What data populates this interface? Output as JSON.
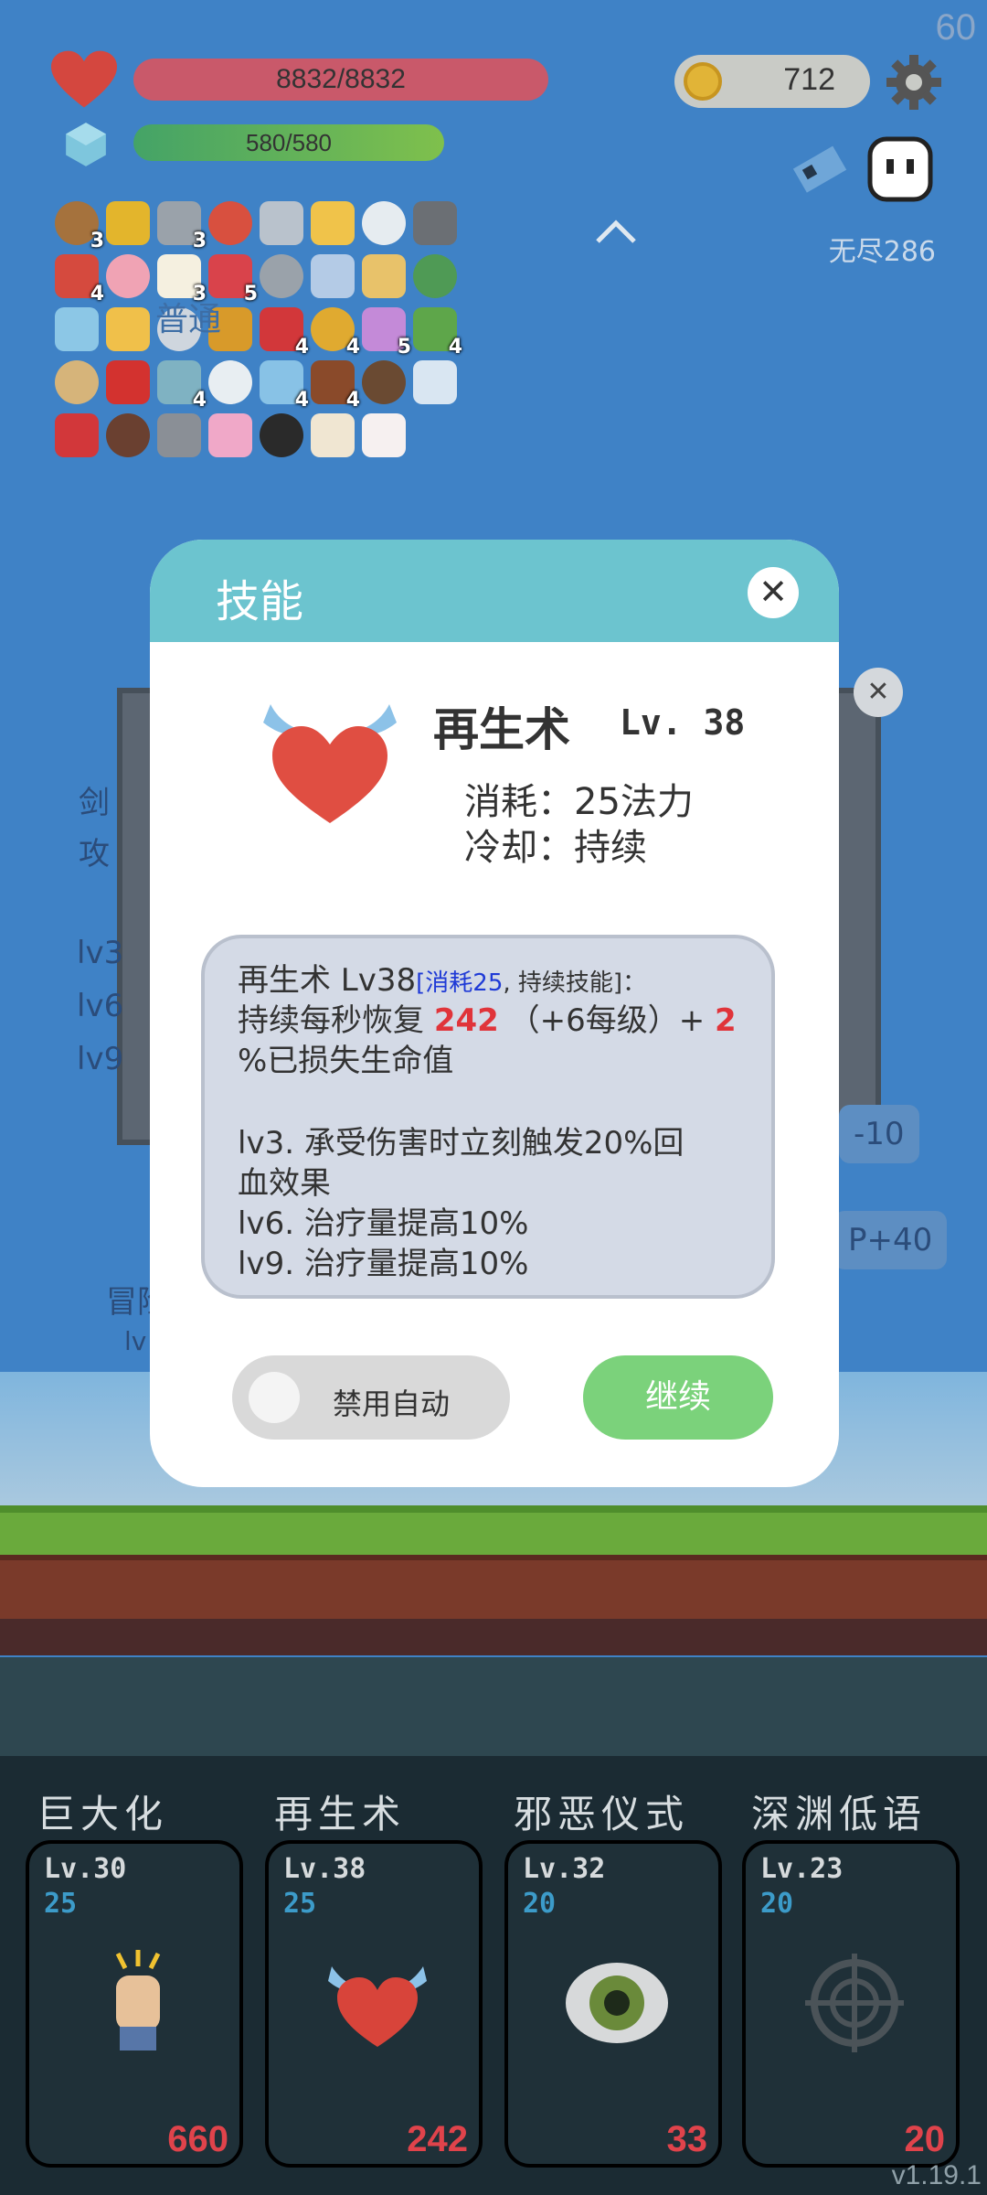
{
  "hud": {
    "fps": "60",
    "hp_text": "8832/8832",
    "mp_text": "580/580",
    "coins": "712",
    "endless_label": "无尽286"
  },
  "items": [
    {
      "icon": "shield-round-icon",
      "count": "3"
    },
    {
      "icon": "sunflower-icon",
      "count": ""
    },
    {
      "icon": "meteor-icon",
      "count": "3"
    },
    {
      "icon": "red-shield-icon",
      "count": ""
    },
    {
      "icon": "sword-icon",
      "count": ""
    },
    {
      "icon": "sun-icon",
      "count": ""
    },
    {
      "icon": "briefcase-icon",
      "count": ""
    },
    {
      "icon": "helmet-icon",
      "count": ""
    },
    {
      "icon": "sock-icon",
      "count": "4"
    },
    {
      "icon": "spray-icon",
      "count": ""
    },
    {
      "icon": "flower-icon",
      "count": "3"
    },
    {
      "icon": "heart-icon",
      "count": "5"
    },
    {
      "icon": "axe-icon",
      "count": ""
    },
    {
      "icon": "shirt-icon",
      "count": ""
    },
    {
      "icon": "map-icon",
      "count": ""
    },
    {
      "icon": "cash-icon",
      "count": ""
    },
    {
      "icon": "feather-icon",
      "count": ""
    },
    {
      "icon": "beer-icon",
      "count": ""
    },
    {
      "icon": "pin-icon",
      "count": ""
    },
    {
      "icon": "pineapple-icon",
      "count": ""
    },
    {
      "icon": "apple-icon",
      "count": "4"
    },
    {
      "icon": "coins-stack-icon",
      "count": "4"
    },
    {
      "icon": "potted-flower-icon",
      "count": "5"
    },
    {
      "icon": "watermelon-icon",
      "count": "4"
    },
    {
      "icon": "scroll-icon",
      "count": ""
    },
    {
      "icon": "magnet-icon",
      "count": ""
    },
    {
      "icon": "target-disc-icon",
      "count": "4"
    },
    {
      "icon": "molecule-icon",
      "count": ""
    },
    {
      "icon": "potion-face-icon",
      "count": "4"
    },
    {
      "icon": "cake-icon",
      "count": "4"
    },
    {
      "icon": "coconut-icon",
      "count": ""
    },
    {
      "icon": "star-card-icon",
      "count": ""
    },
    {
      "icon": "strawberry-icon",
      "count": ""
    },
    {
      "icon": "pirate-ship-icon",
      "count": ""
    },
    {
      "icon": "spiked-ball-icon",
      "count": ""
    },
    {
      "icon": "calendar-icon",
      "count": ""
    },
    {
      "icon": "playing-card-icon",
      "count": ""
    },
    {
      "icon": "paper-icon",
      "count": ""
    },
    {
      "icon": "jar-icon",
      "count": ""
    }
  ],
  "background": {
    "label_normal": "普通",
    "text1": "剑",
    "text2": "攻",
    "text3": "lv3",
    "text4": "lv6",
    "text5": "lv9",
    "chip1": "-10",
    "chip2": "P+40",
    "adventure": "冒险",
    "adventure_lv": "lv"
  },
  "modal": {
    "title": "技能",
    "skill_name": "再生术",
    "skill_level": "Lv. 38",
    "cost_line": "消耗：25法力",
    "cooldown_line": "冷却：持续",
    "desc": {
      "line1_prefix": "再生术 Lv38",
      "line1_bracket_open": "[",
      "line1_cost": "消耗25",
      "line1_rest": ", 持续技能]：",
      "line2_prefix": "持续每秒恢复 ",
      "line2_value": "242",
      "line2_mid": " （+6每级）+ ",
      "line2_pct": "2",
      "line3": "%已损失生命值",
      "line4": "lv3. 承受伤害时立刻触发20%回",
      "line5": "血效果",
      "line6": "lv6. 治疗量提高10%",
      "line7": "lv9. 治疗量提高10%"
    },
    "toggle_label": "禁用自动",
    "continue_label": "继续"
  },
  "skills": [
    {
      "name": "巨大化",
      "level": "Lv.30",
      "cost": "25",
      "value": "660",
      "icon": "fist-icon"
    },
    {
      "name": "再生术",
      "level": "Lv.38",
      "cost": "25",
      "value": "242",
      "icon": "winged-heart-icon"
    },
    {
      "name": "邪恶仪式",
      "level": "Lv.32",
      "cost": "20",
      "value": "33",
      "icon": "eye-icon"
    },
    {
      "name": "深渊低语",
      "level": "Lv.23",
      "cost": "20",
      "value": "20",
      "icon": "crosshair-icon"
    }
  ],
  "version": "v1.19.1"
}
